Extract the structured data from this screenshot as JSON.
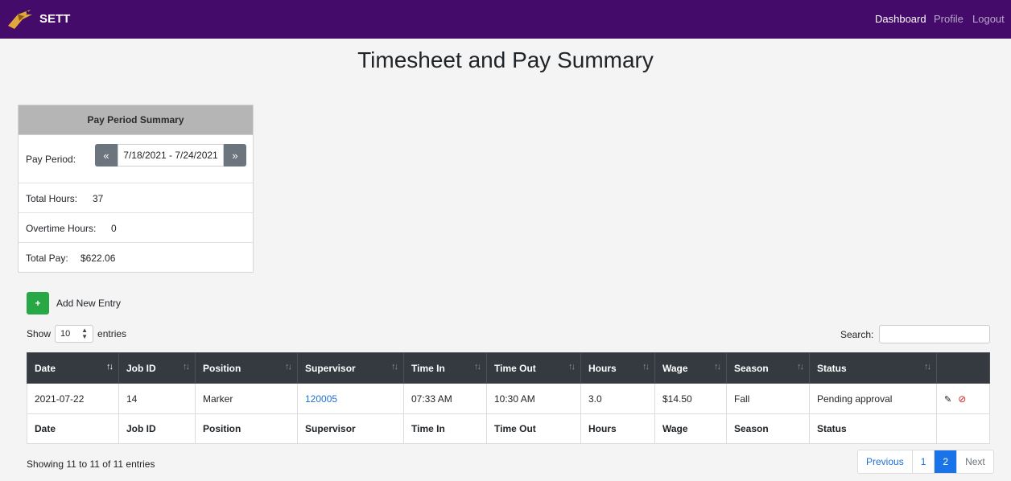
{
  "navbar": {
    "brand": "SETT",
    "links": [
      {
        "label": "Dashboard",
        "active": true
      },
      {
        "label": "Profile",
        "active": false
      },
      {
        "label": "Logout",
        "active": false
      }
    ]
  },
  "page_title": "Timesheet and Pay Summary",
  "summary": {
    "title": "Pay Period Summary",
    "period_label": "Pay Period:",
    "period_value": "7/18/2021 - 7/24/2021",
    "prev_symbol": "«",
    "next_symbol": "»",
    "total_hours_label": "Total Hours:",
    "total_hours_value": "37",
    "overtime_label": "Overtime Hours:",
    "overtime_value": "0",
    "total_pay_label": "Total Pay:",
    "total_pay_value": "$622.06"
  },
  "add_entry": {
    "button": "+",
    "label": "Add New Entry"
  },
  "length": {
    "prefix": "Show",
    "value": "10",
    "suffix": "entries"
  },
  "search": {
    "label": "Search:",
    "value": ""
  },
  "table": {
    "columns": [
      "Date",
      "Job ID",
      "Position",
      "Supervisor",
      "Time In",
      "Time Out",
      "Hours",
      "Wage",
      "Season",
      "Status"
    ],
    "rows": [
      {
        "date": "2021-07-22",
        "job_id": "14",
        "position": "Marker",
        "supervisor": "120005",
        "time_in": "07:33 AM",
        "time_out": "10:30 AM",
        "hours": "3.0",
        "wage": "$14.50",
        "season": "Fall",
        "status": "Pending approval"
      }
    ]
  },
  "info": "Showing 11 to 11 of 11 entries",
  "pagination": {
    "previous": "Previous",
    "pages": [
      "1",
      "2"
    ],
    "active_page": "2",
    "next": "Next"
  },
  "colors": {
    "navbar": "#450b6b",
    "table_header": "#343a40",
    "add_button": "#28a745",
    "link": "#1e6fd8",
    "delete_icon": "#d21e1e"
  }
}
